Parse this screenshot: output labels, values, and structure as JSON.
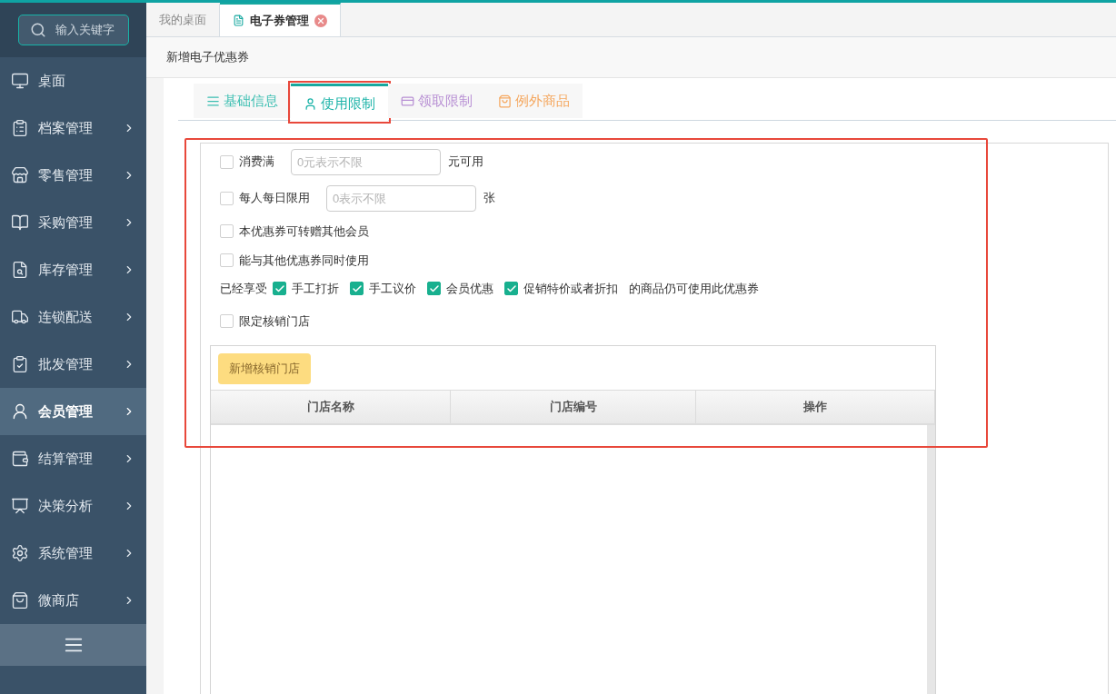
{
  "sidebar": {
    "search": {
      "placeholder": "输入关键字"
    },
    "items": [
      {
        "label": "桌面",
        "expandable": false,
        "selected": false
      },
      {
        "label": "档案管理",
        "expandable": true,
        "selected": false
      },
      {
        "label": "零售管理",
        "expandable": true,
        "selected": false
      },
      {
        "label": "采购管理",
        "expandable": true,
        "selected": false
      },
      {
        "label": "库存管理",
        "expandable": true,
        "selected": false
      },
      {
        "label": "连锁配送",
        "expandable": true,
        "selected": false
      },
      {
        "label": "批发管理",
        "expandable": true,
        "selected": false
      },
      {
        "label": "会员管理",
        "expandable": true,
        "selected": true
      },
      {
        "label": "结算管理",
        "expandable": true,
        "selected": false
      },
      {
        "label": "决策分析",
        "expandable": true,
        "selected": false
      },
      {
        "label": "系统管理",
        "expandable": true,
        "selected": false
      },
      {
        "label": "微商店",
        "expandable": true,
        "selected": false
      }
    ]
  },
  "tabs": [
    {
      "label": "我的桌面",
      "selected": false,
      "closable": false
    },
    {
      "label": "电子券管理",
      "selected": true,
      "closable": true
    }
  ],
  "page_title": "新增电子优惠券",
  "section_tabs": [
    {
      "label": "基础信息",
      "selected": false,
      "color": "#3dbfb2",
      "highlighted": false
    },
    {
      "label": "使用限制",
      "selected": true,
      "color": "#1cb3a8",
      "highlighted": true
    },
    {
      "label": "领取限制",
      "selected": false,
      "color": "#b890d4",
      "highlighted": false
    },
    {
      "label": "例外商品",
      "selected": false,
      "color": "#f5a860",
      "highlighted": false
    }
  ],
  "form": {
    "highlighted": true,
    "rows": [
      {
        "kind": "input",
        "checked": false,
        "label": "消费满",
        "placeholder": "0元表示不限",
        "suffix": "元可用"
      },
      {
        "kind": "input",
        "checked": false,
        "label": "每人每日限用",
        "placeholder": "0表示不限",
        "suffix": "张"
      },
      {
        "kind": "check",
        "checked": false,
        "label": "本优惠券可转赠其他会员"
      },
      {
        "kind": "check",
        "checked": false,
        "label": "能与其他优惠券同时使用"
      },
      {
        "kind": "multi",
        "prefix": "已经享受",
        "suffix": "的商品仍可使用此优惠券",
        "options": [
          {
            "label": "手工打折",
            "checked": true
          },
          {
            "label": "手工议价",
            "checked": true
          },
          {
            "label": "会员优惠",
            "checked": true
          },
          {
            "label": "促销特价或者折扣",
            "checked": true
          }
        ]
      },
      {
        "kind": "check",
        "checked": false,
        "label": "限定核销门店"
      }
    ]
  },
  "store_table": {
    "add_button": "新增核销门店",
    "columns": [
      "门店名称",
      "门店编号",
      "操作"
    ]
  }
}
